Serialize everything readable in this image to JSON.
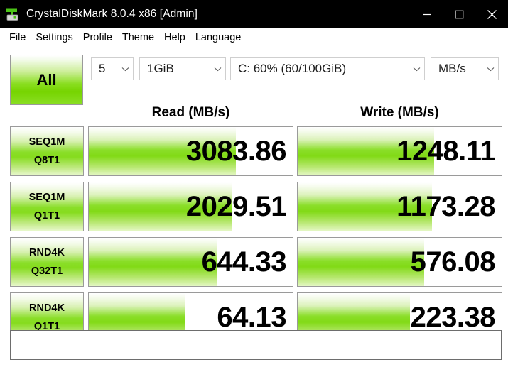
{
  "window": {
    "title": "CrystalDiskMark 8.0.4 x86 [Admin]",
    "app_icon": "disk-benchmark-icon",
    "controls": {
      "minimize": "minimize-icon",
      "maximize": "maximize-icon",
      "close": "close-icon"
    }
  },
  "menu": {
    "items": [
      {
        "label": "File"
      },
      {
        "label": "Settings"
      },
      {
        "label": "Profile"
      },
      {
        "label": "Theme"
      },
      {
        "label": "Help"
      },
      {
        "label": "Language"
      }
    ]
  },
  "toolbar": {
    "all_button": "All",
    "count": "5",
    "size": "1GiB",
    "drive": "C: 60% (60/100GiB)",
    "unit": "MB/s",
    "chevron_icon": "chevron-down-icon"
  },
  "columns": {
    "read": "Read (MB/s)",
    "write": "Write (MB/s)"
  },
  "colors": {
    "bar_green": "#82da16",
    "bar_green_light": "#e4f7c4",
    "titlebar_bg": "#000000",
    "titlebar_fg": "#ffffff",
    "border": "#9a9a9a"
  },
  "chart_data": {
    "type": "bar",
    "title": "CrystalDiskMark 8.0.4 x86 [Admin]",
    "xlabel": "",
    "ylabel": "MB/s",
    "unit": "MB/s",
    "test_count": 5,
    "test_size": "1GiB",
    "target_drive": "C: 60% (60/100GiB)",
    "categories": [
      "SEQ1M Q8T1",
      "SEQ1M Q1T1",
      "RND4K Q32T1",
      "RND4K Q1T1"
    ],
    "series": [
      {
        "name": "Read (MB/s)",
        "values": [
          3083.86,
          2029.51,
          644.33,
          64.13
        ]
      },
      {
        "name": "Write (MB/s)",
        "values": [
          1248.11,
          1173.28,
          576.08,
          223.38
        ]
      }
    ],
    "legend_position": "top"
  },
  "rows": [
    {
      "label_line1": "SEQ1M",
      "label_line2": "Q8T1",
      "read": {
        "value": "3083.86",
        "fill_pct": 72
      },
      "write": {
        "value": "1248.11",
        "fill_pct": 67
      }
    },
    {
      "label_line1": "SEQ1M",
      "label_line2": "Q1T1",
      "read": {
        "value": "2029.51",
        "fill_pct": 70
      },
      "write": {
        "value": "1173.28",
        "fill_pct": 66
      }
    },
    {
      "label_line1": "RND4K",
      "label_line2": "Q32T1",
      "read": {
        "value": "644.33",
        "fill_pct": 63
      },
      "write": {
        "value": "576.08",
        "fill_pct": 62
      }
    },
    {
      "label_line1": "RND4K",
      "label_line2": "Q1T1",
      "read": {
        "value": "64.13",
        "fill_pct": 47
      },
      "write": {
        "value": "223.38",
        "fill_pct": 55
      }
    }
  ],
  "status_box": {
    "text": ""
  }
}
